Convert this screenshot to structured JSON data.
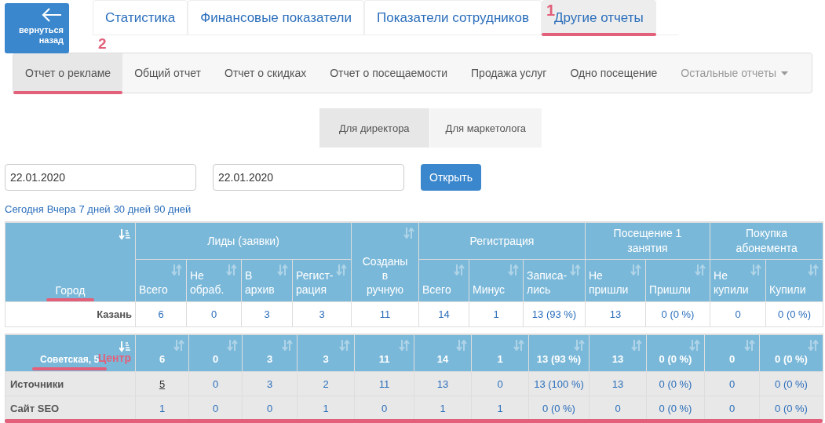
{
  "back_button": {
    "label": "вернуться назад"
  },
  "top_tabs": [
    {
      "label": "Статистика",
      "selected": false,
      "underlined": false
    },
    {
      "label": "Финансовые показатели",
      "selected": false,
      "underlined": false
    },
    {
      "label": "Показатели сотрудников",
      "selected": false,
      "underlined": false
    },
    {
      "label": "Другие отчеты",
      "selected": true,
      "annotation": "1",
      "underlined": true
    }
  ],
  "report_nav": [
    {
      "label": "Отчет о рекламе",
      "selected": true,
      "kind": "link",
      "annotation": "2",
      "underlined": true
    },
    {
      "label": "Общий отчет",
      "selected": false,
      "kind": "link",
      "underlined": false
    },
    {
      "label": "Отчет о скидках",
      "selected": false,
      "kind": "link",
      "underlined": false
    },
    {
      "label": "Отчет о посещаемости",
      "selected": false,
      "kind": "link",
      "underlined": false
    },
    {
      "label": "Продажа услуг",
      "selected": false,
      "kind": "link",
      "underlined": false
    },
    {
      "label": "Одно посещение",
      "selected": false,
      "kind": "link",
      "underlined": false
    },
    {
      "label": "Остальные отчеты",
      "selected": false,
      "kind": "dropdown",
      "underlined": false
    }
  ],
  "role_tabs": [
    {
      "label": "Для директора",
      "selected": true
    },
    {
      "label": "Для маркетолога",
      "selected": false
    }
  ],
  "date_from": {
    "value": "22.01.2020"
  },
  "date_to": {
    "value": "22.01.2020"
  },
  "open_button": {
    "label": "Открыть"
  },
  "quick_ranges": [
    "Сегодня",
    "Вчера",
    "7 дней",
    "30 дней",
    "90 дней"
  ],
  "city_table": {
    "first_column": {
      "label": "Город",
      "underlined": true
    },
    "groups": [
      {
        "label": "Лиды (заявки)",
        "columns": [
          "Всего",
          "Не\nобраб.",
          "В\nархив",
          "Регист-\nрация"
        ]
      },
      {
        "label": "Созданы\nв\nручную"
      },
      {
        "label": "Регистрация",
        "columns": [
          "Всего",
          "Минус",
          "Записа-\nлись"
        ]
      },
      {
        "label": "Посещение 1\nзанятия",
        "columns": [
          "Не\nпришли",
          "Пришли"
        ]
      },
      {
        "label": "Покупка\nабонемента",
        "columns": [
          "Не\nкупили",
          "Купили"
        ]
      }
    ],
    "rows": [
      {
        "city": "Казань",
        "cells": [
          "6",
          "0",
          "3",
          "3",
          "11",
          "14",
          "1",
          "13 (93 %)",
          "13",
          "0 (0 %)",
          "0",
          "0 (0 %)"
        ]
      }
    ]
  },
  "branch_table": {
    "label": "Советская, 5",
    "annotation": "Центр",
    "underlined": true,
    "bottom_underlined": true,
    "totals": [
      "6",
      "0",
      "3",
      "3",
      "11",
      "14",
      "1",
      "13 (93 %)",
      "13",
      "0 (0 %)",
      "0",
      "0 (0 %)"
    ],
    "rows": [
      {
        "label": "Источники",
        "cells": [
          {
            "text": "5",
            "link": true
          },
          {
            "text": "0",
            "link": false
          },
          {
            "text": "3",
            "link": false
          },
          {
            "text": "2",
            "link": false
          },
          {
            "text": "11",
            "link": false
          },
          {
            "text": "13",
            "link": false
          },
          {
            "text": "0",
            "link": false
          },
          {
            "text": "13 (100 %)",
            "link": false
          },
          {
            "text": "13",
            "link": false
          },
          {
            "text": "0 (0 %)",
            "link": false
          },
          {
            "text": "0",
            "link": false
          },
          {
            "text": "0 (0 %)",
            "link": false
          }
        ]
      },
      {
        "label": "Сайт SEO",
        "cells": [
          {
            "text": "1",
            "link": false
          },
          {
            "text": "0",
            "link": false
          },
          {
            "text": "0",
            "link": false
          },
          {
            "text": "1",
            "link": false
          },
          {
            "text": "0",
            "link": false
          },
          {
            "text": "1",
            "link": false
          },
          {
            "text": "1",
            "link": false
          },
          {
            "text": "0 (0 %)",
            "link": false
          },
          {
            "text": "0",
            "link": false
          },
          {
            "text": "0 (0 %)",
            "link": false
          },
          {
            "text": "0",
            "link": false
          },
          {
            "text": "0 (0 %)",
            "link": false
          }
        ]
      }
    ]
  }
}
